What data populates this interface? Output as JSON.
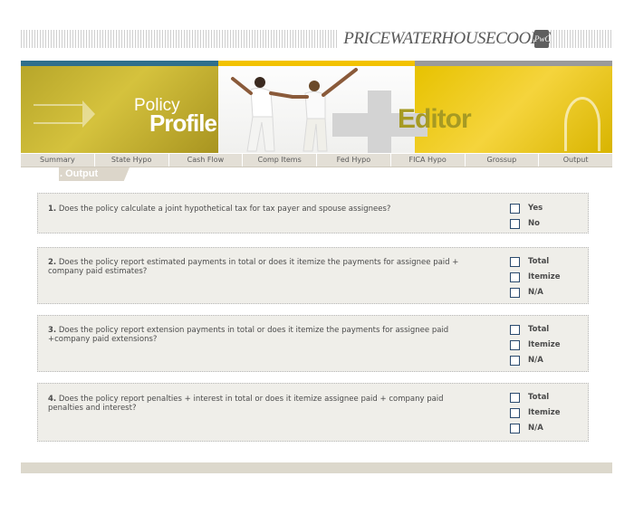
{
  "brand": {
    "logo_text": "PRICEWATERHOUSECOOPERS",
    "logo_mark": "PwC"
  },
  "banner": {
    "title_policy": "Policy",
    "title_profile": "Profile",
    "title_editor": "Editor"
  },
  "tabs": [
    "Summary",
    "State Hypo",
    "Cash Flow",
    "Comp Items",
    "Fed Hypo",
    "FICA Hypo",
    "Grossup",
    "Output"
  ],
  "section": {
    "label": ". Output"
  },
  "questions": [
    {
      "num": "1.",
      "text": "Does the policy calculate a joint hypothetical tax for tax payer and spouse assignees?",
      "options": [
        "Yes",
        "No"
      ]
    },
    {
      "num": "2.",
      "text": "Does the policy report estimated payments in total or does it itemize the payments for assignee paid + company paid estimates?",
      "options": [
        "Total",
        "Itemize",
        "N/A"
      ]
    },
    {
      "num": "3.",
      "text": "Does the policy report extension payments in total or does it itemize the payments for assignee paid +company paid extensions?",
      "options": [
        "Total",
        "Itemize",
        "N/A"
      ]
    },
    {
      "num": "4.",
      "text": "Does the policy report penalties + interest in total or does it itemize assignee paid + company paid penalties and interest?",
      "options": [
        "Total",
        "Itemize",
        "N/A"
      ]
    }
  ]
}
